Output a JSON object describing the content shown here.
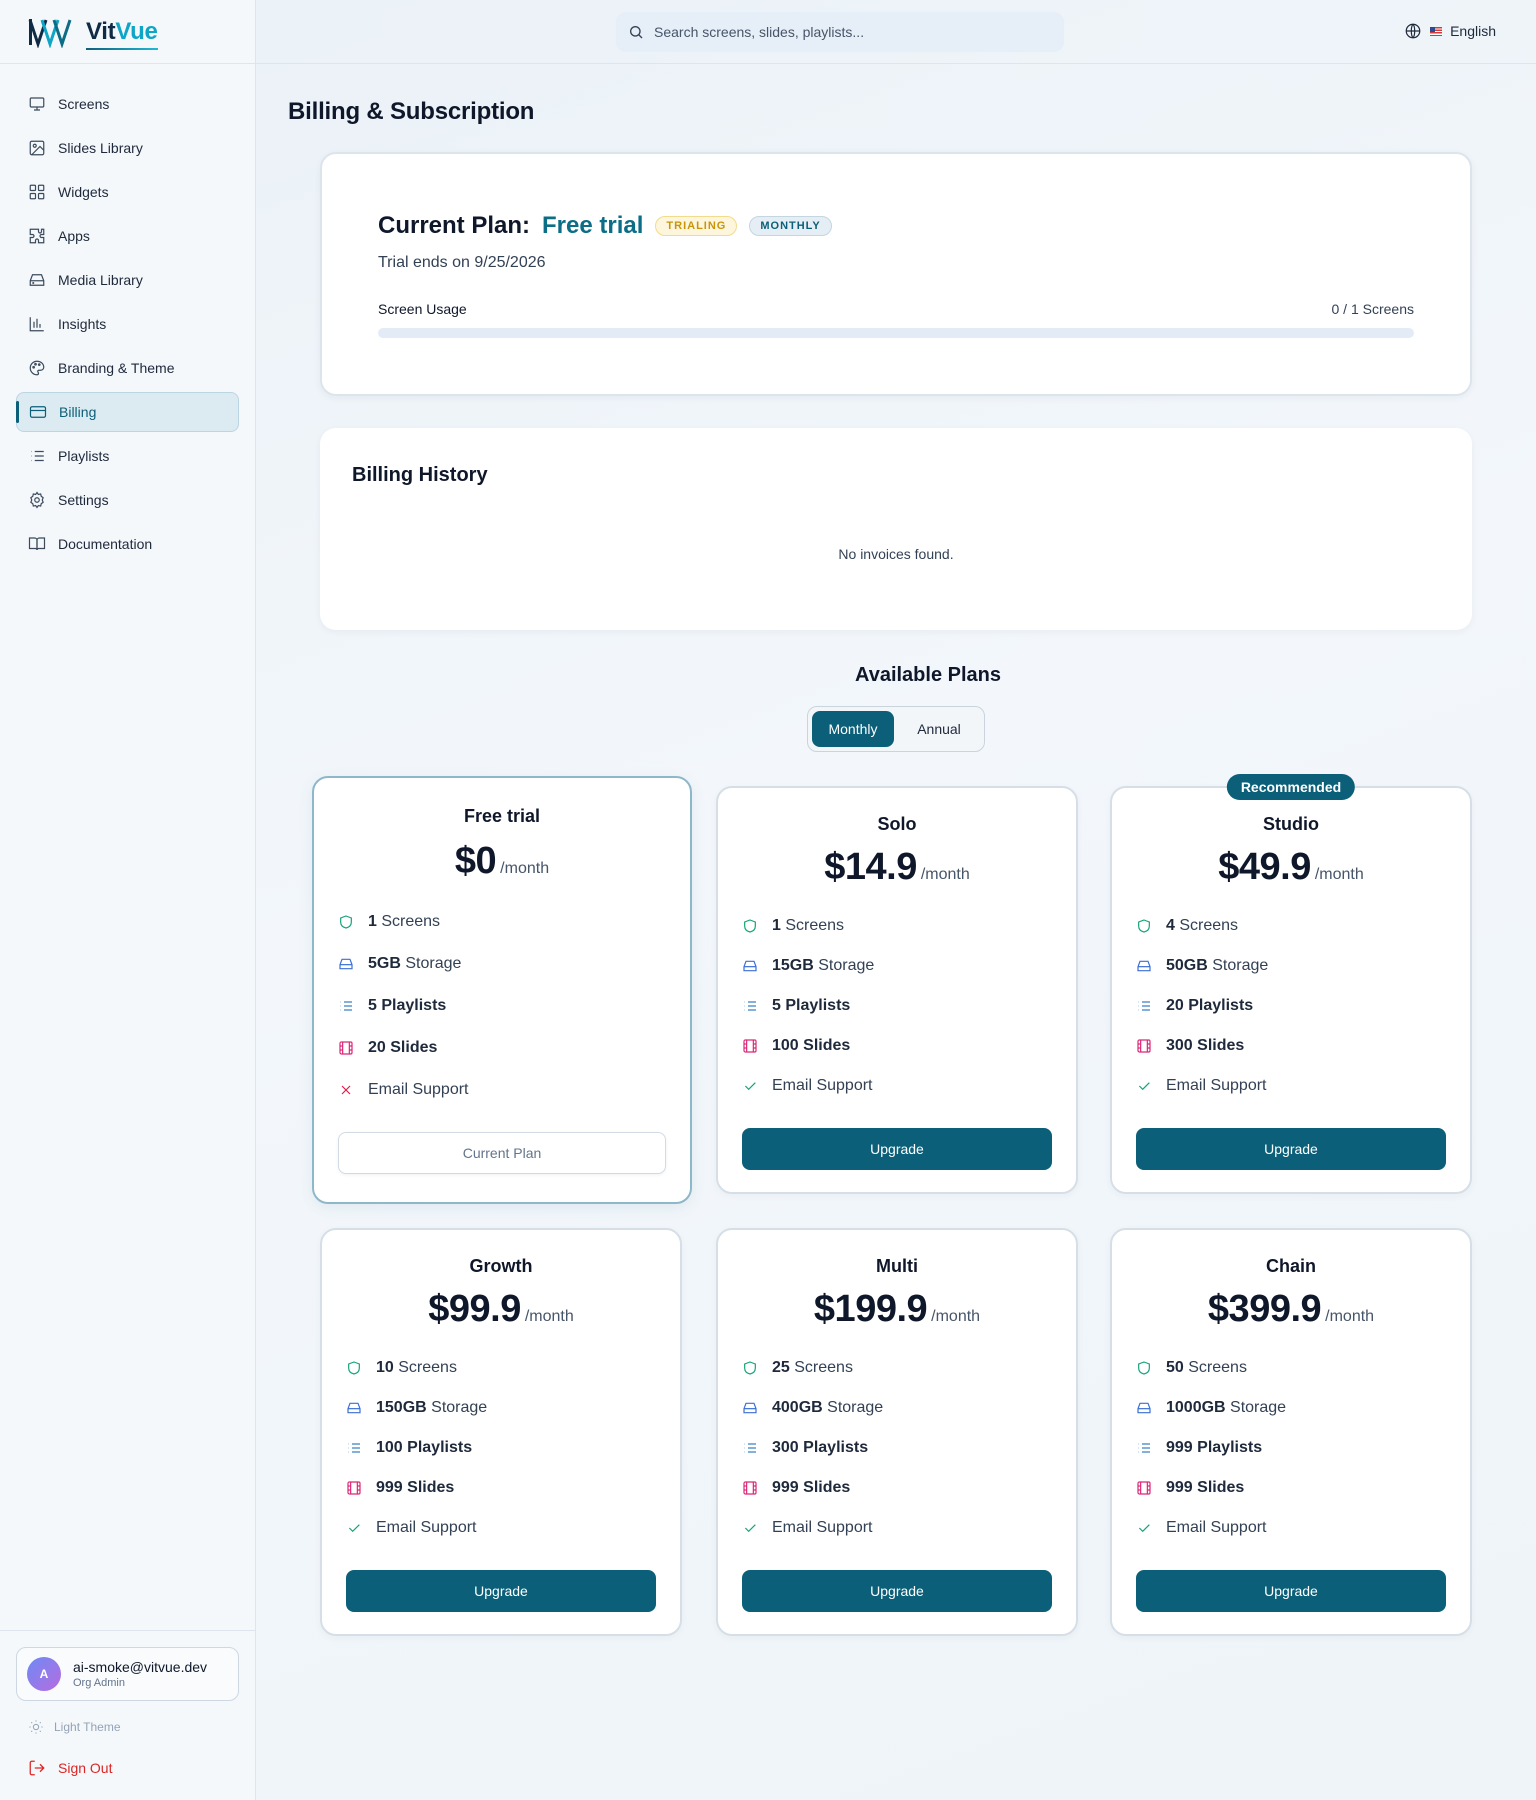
{
  "brand": {
    "name_part1": "Vit",
    "name_part2": "Vue"
  },
  "search": {
    "placeholder": "Search screens, slides, playlists..."
  },
  "language": {
    "label": "English"
  },
  "sidebar": {
    "items": [
      {
        "label": "Screens",
        "icon": "monitor-icon"
      },
      {
        "label": "Slides Library",
        "icon": "image-icon"
      },
      {
        "label": "Widgets",
        "icon": "grid-icon"
      },
      {
        "label": "Apps",
        "icon": "puzzle-icon"
      },
      {
        "label": "Media Library",
        "icon": "hard-drive-icon"
      },
      {
        "label": "Insights",
        "icon": "bar-chart-icon"
      },
      {
        "label": "Branding & Theme",
        "icon": "palette-icon"
      },
      {
        "label": "Billing",
        "icon": "credit-card-icon",
        "active": true
      },
      {
        "label": "Playlists",
        "icon": "list-icon"
      },
      {
        "label": "Settings",
        "icon": "gear-icon"
      },
      {
        "label": "Documentation",
        "icon": "book-icon"
      }
    ]
  },
  "user": {
    "avatar_initial": "A",
    "email": "ai-smoke@vitvue.dev",
    "role": "Org Admin"
  },
  "theme_toggle": {
    "label": "Light Theme"
  },
  "sign_out": {
    "label": "Sign Out"
  },
  "page": {
    "title": "Billing & Subscription"
  },
  "current_plan": {
    "label": "Current Plan:",
    "name": "Free trial",
    "status_badge": "TRIALING",
    "cycle_badge": "MONTHLY",
    "trial_text": "Trial ends on 9/25/2026",
    "usage_label": "Screen Usage",
    "usage_value": "0 / 1 Screens",
    "usage_fraction": 0
  },
  "billing_history": {
    "title": "Billing History",
    "empty_text": "No invoices found."
  },
  "available_plans": {
    "title": "Available Plans",
    "toggle": {
      "monthly": "Monthly",
      "annual": "Annual",
      "selected": "monthly"
    },
    "recommended_badge": "Recommended",
    "per_label": "/month",
    "plans": [
      {
        "name": "Free trial",
        "price": "$0",
        "screens": "1",
        "storage": "5GB",
        "playlists": "5",
        "slides": "20",
        "support": "Email Support",
        "support_included": false,
        "button": "Current Plan"
      },
      {
        "name": "Solo",
        "price": "$14.9",
        "screens": "1",
        "storage": "15GB",
        "playlists": "5",
        "slides": "100",
        "support": "Email Support",
        "support_included": true,
        "button": "Upgrade"
      },
      {
        "name": "Studio",
        "price": "$49.9",
        "screens": "4",
        "storage": "50GB",
        "playlists": "20",
        "slides": "300",
        "support": "Email Support",
        "support_included": true,
        "button": "Upgrade"
      },
      {
        "name": "Growth",
        "price": "$99.9",
        "screens": "10",
        "storage": "150GB",
        "playlists": "100",
        "slides": "999",
        "support": "Email Support",
        "support_included": true,
        "button": "Upgrade"
      },
      {
        "name": "Multi",
        "price": "$199.9",
        "screens": "25",
        "storage": "400GB",
        "playlists": "300",
        "slides": "999",
        "support": "Email Support",
        "support_included": true,
        "button": "Upgrade"
      },
      {
        "name": "Chain",
        "price": "$399.9",
        "screens": "50",
        "storage": "1000GB",
        "playlists": "999",
        "slides": "999",
        "support": "Email Support",
        "support_included": true,
        "button": "Upgrade"
      }
    ],
    "feature_suffix": {
      "screens": "Screens",
      "storage": "Storage",
      "playlists": "Playlists",
      "slides": "Slides"
    }
  }
}
